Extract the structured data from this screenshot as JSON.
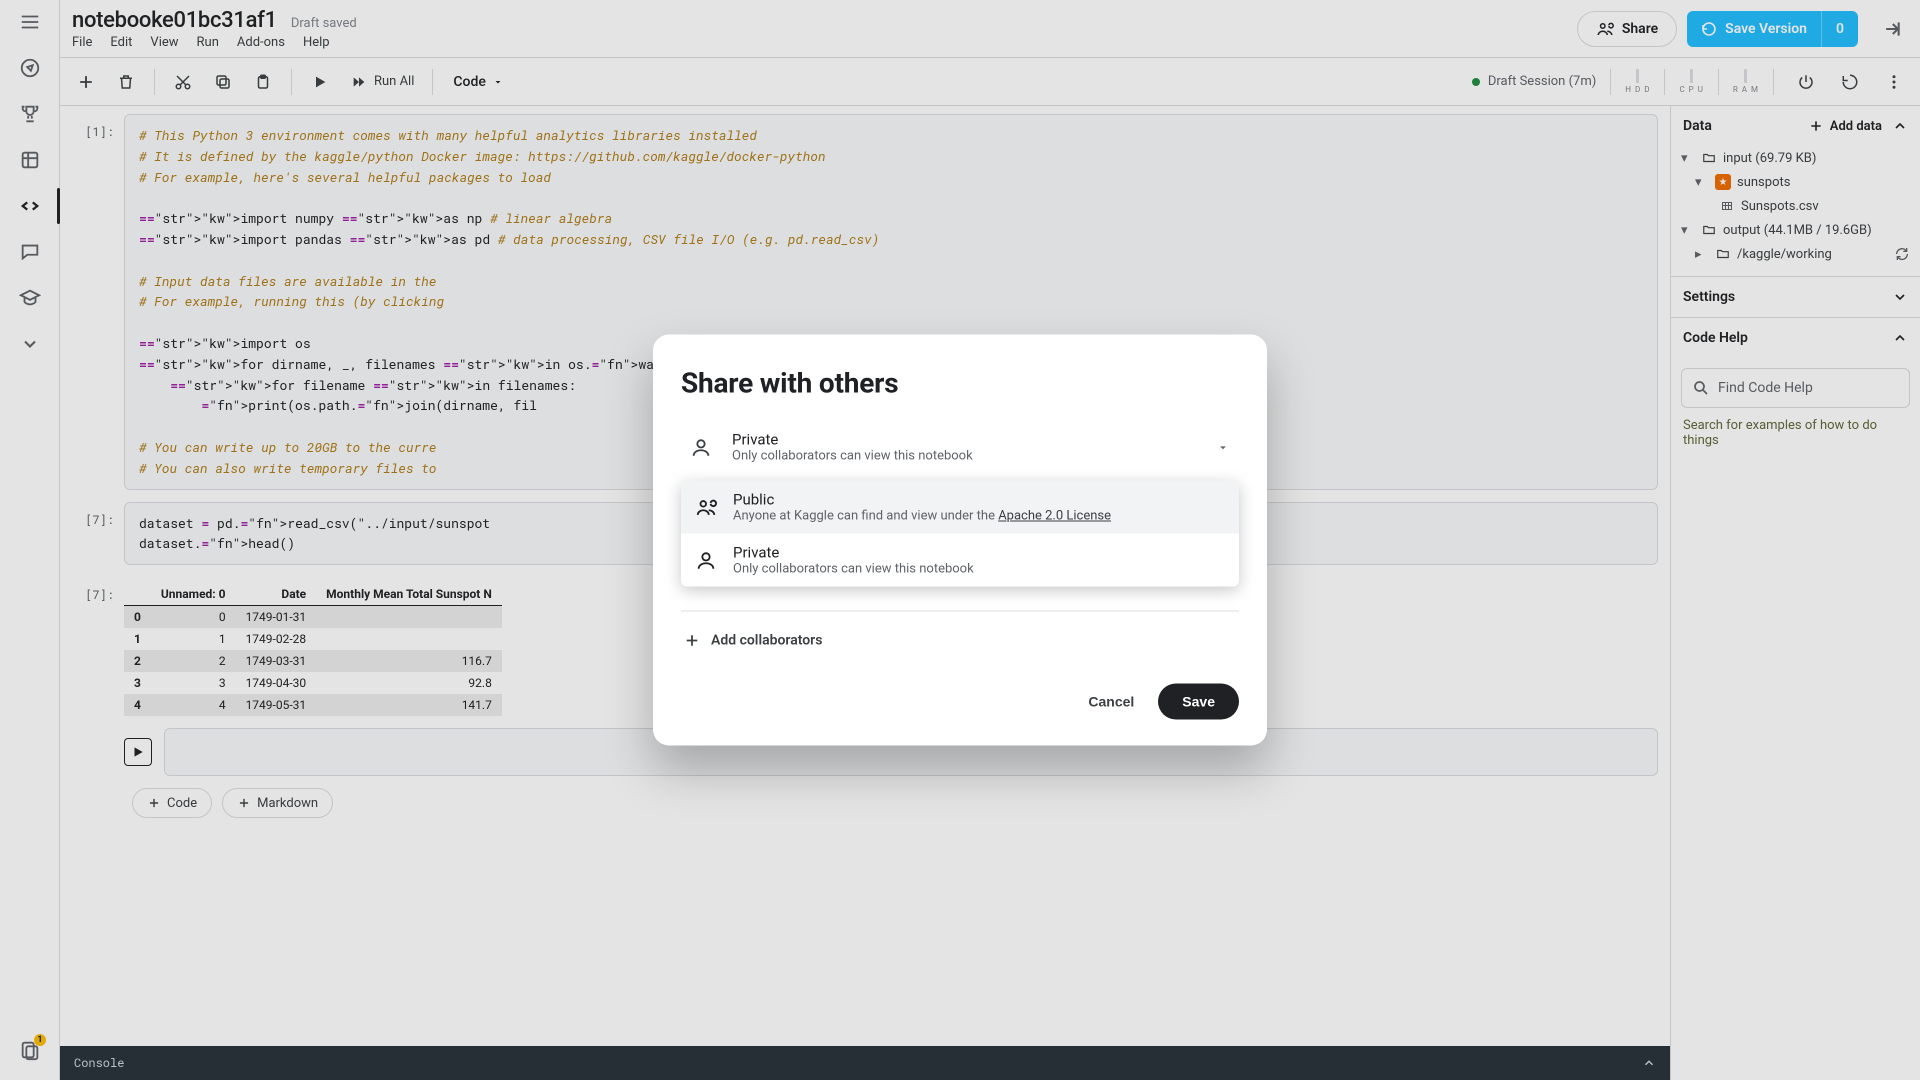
{
  "title": "notebooke01bc31af1",
  "draft_status": "Draft saved",
  "menu": {
    "file": "File",
    "edit": "Edit",
    "view": "View",
    "run": "Run",
    "addons": "Add-ons",
    "help": "Help"
  },
  "toolbar": {
    "runall": "Run All",
    "celltype": "Code",
    "session": "Draft Session (7m)",
    "sparks": {
      "hdd": "H\nD\nD",
      "cpu": "C\nP\nU",
      "ram": "R\nA\nM"
    }
  },
  "header_actions": {
    "share": "Share",
    "save_version": "Save Version",
    "count": "0"
  },
  "cells": {
    "c1_prompt": "[1]:",
    "c1_code": "# This Python 3 environment comes with many helpful analytics libraries installed\n# It is defined by the kaggle/python Docker image: https://github.com/kaggle/docker-python\n# For example, here's several helpful packages to load\n\nimport numpy as np # linear algebra\nimport pandas as pd # data processing, CSV file I/O (e.g. pd.read_csv)\n\n# Input data files are available in the \n# For example, running this (by clicking\n\nimport os\nfor dirname, _, filenames in os.walk('/k\n    for filename in filenames:\n        print(os.path.join(dirname, fil\n\n# You can write up to 20GB to the curre                                                                                   n using \"Save & Run\n# You can also write temporary files to",
    "c2_prompt": "[7]:",
    "c2_code": "dataset = pd.read_csv(\"../input/sunspot\ndataset.head()",
    "c3_out_prompt": "[7]:"
  },
  "table": {
    "headers": [
      "",
      "Unnamed: 0",
      "Date",
      "Monthly Mean Total Sunspot N"
    ],
    "rows": [
      [
        "0",
        "0",
        "1749-01-31",
        ""
      ],
      [
        "1",
        "1",
        "1749-02-28",
        ""
      ],
      [
        "2",
        "2",
        "1749-03-31",
        "116.7"
      ],
      [
        "3",
        "3",
        "1749-04-30",
        "92.8"
      ],
      [
        "4",
        "4",
        "1749-05-31",
        "141.7"
      ]
    ]
  },
  "chips": {
    "code": "Code",
    "markdown": "Markdown"
  },
  "console": "Console",
  "right": {
    "data": "Data",
    "add": "Add data",
    "input": "input (69.79 KB)",
    "dataset": "sunspots",
    "file": "Sunspots.csv",
    "output": "output (44.1MB / 19.6GB)",
    "working": "/kaggle/working",
    "settings": "Settings",
    "codehelp": "Code Help",
    "search_ph": "Find Code Help",
    "hint": "Search for examples of how to do things"
  },
  "modal": {
    "title": "Share with others",
    "selected_t1": "Private",
    "selected_t2": "Only collaborators can view this notebook",
    "opt_public_t1": "Public",
    "opt_public_t2a": "Anyone at Kaggle can find and view under the ",
    "opt_public_t2b": "Apache 2.0 License",
    "opt_private_t1": "Private",
    "opt_private_t2": "Only collaborators can view this notebook",
    "addcollab": "Add collaborators",
    "cancel": "Cancel",
    "save": "Save"
  },
  "rail_badge": "1"
}
